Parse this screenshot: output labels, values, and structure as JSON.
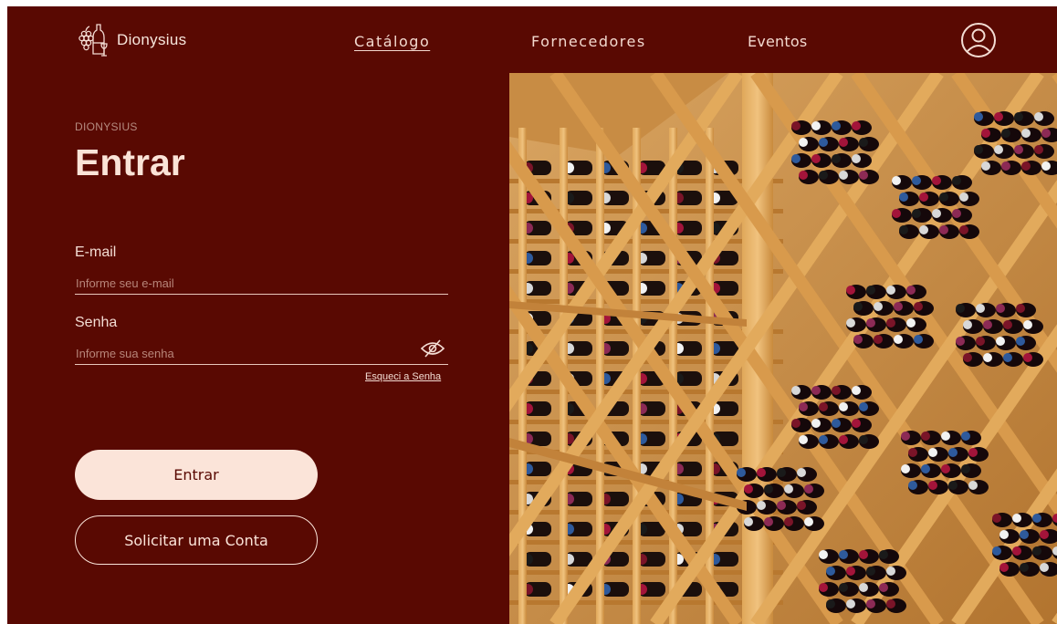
{
  "header": {
    "brand": "Dionysius",
    "logo_icon": "wine-grapes-logo",
    "nav": [
      {
        "label": "Catálogo",
        "active": true
      },
      {
        "label": "Fornecedores",
        "active": false
      },
      {
        "label": "Eventos",
        "active": false
      }
    ],
    "profile_icon": "user-circle-icon"
  },
  "login": {
    "eyebrow": "DIONYSIUS",
    "title": "Entrar",
    "email_label": "E-mail",
    "email_placeholder": "Informe seu e-mail",
    "email_value": "",
    "password_label": "Senha",
    "password_placeholder": "Informe sua senha",
    "password_value": "",
    "toggle_icon": "eye-slash-icon",
    "forgot_link": "Esqueci a Senha",
    "submit_label": "Entrar",
    "request_account_label": "Solicitar uma Conta"
  },
  "hero_image": {
    "subject": "wine-cellar-photo"
  },
  "colors": {
    "background": "#590902",
    "text_light": "#fbe4d9",
    "muted": "#b58b80",
    "wood": "#c98a3c"
  }
}
